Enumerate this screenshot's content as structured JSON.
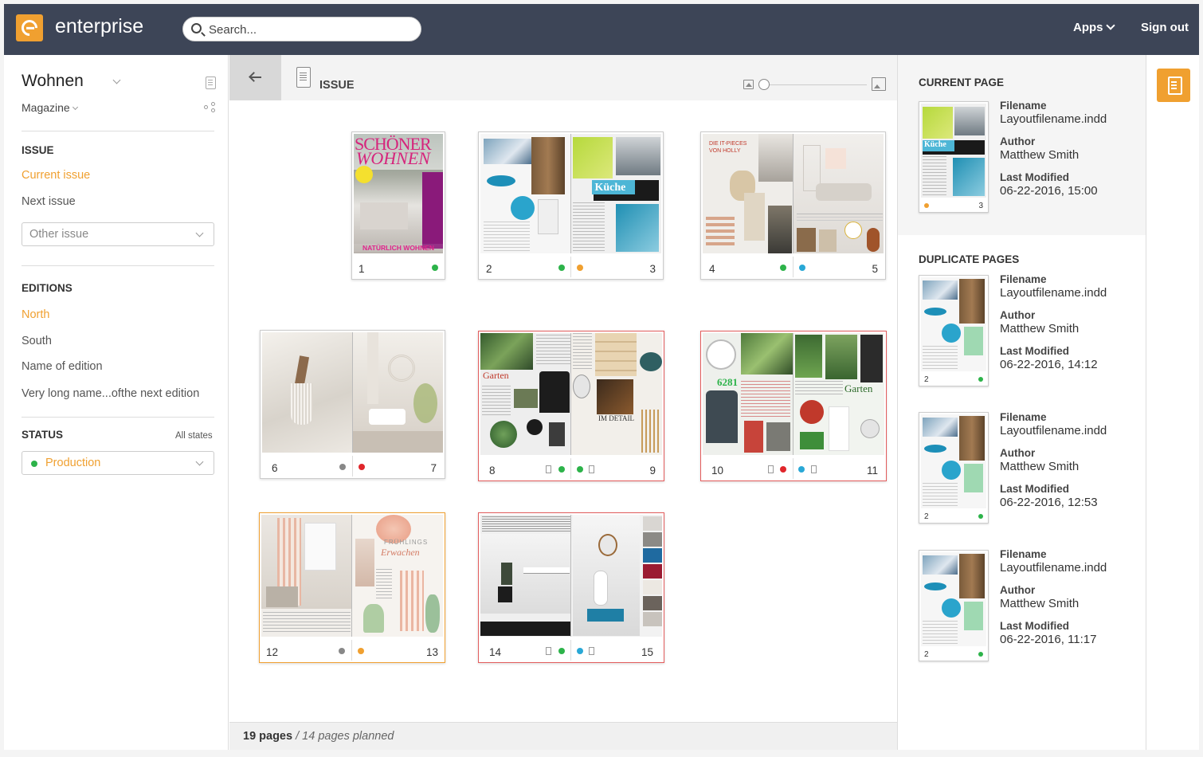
{
  "header": {
    "brand": "enterprise",
    "search_placeholder": "Search...",
    "apps_label": "Apps",
    "signout_label": "Sign out"
  },
  "sidebar": {
    "publication": "Wohnen",
    "publication_type": "Magazine",
    "issue_section": "ISSUE",
    "issue_items": [
      "Current issue",
      "Next issue"
    ],
    "other_issue_placeholder": "Other issue",
    "editions_section": "EDITIONS",
    "edition_items": [
      "North",
      "South",
      "Name of edition",
      "Very long name...ofthe next edition"
    ],
    "status_section": "STATUS",
    "all_states": "All states",
    "status_value": "Production"
  },
  "center": {
    "header_label": "ISSUE",
    "footer_count": "19 pages",
    "footer_planned": "/ 14 pages planned",
    "cover_text_1": "SCHÖNER",
    "cover_text_2": "WOHNEN",
    "cover_text_3": "NATÜRLICH WOHNEN",
    "label_kueche": "Küche",
    "label_it_pieces": "DIE IT-PIECES VON HOLLY",
    "label_garten": "Garten",
    "label_im_detail": "IM DETAIL",
    "label_6281": "6281",
    "label_fruehlings": "FRÜHLINGS",
    "label_erwachen": "Erwachen",
    "cards": [
      {
        "left": "1",
        "right": ""
      },
      {
        "left": "2",
        "right": "3"
      },
      {
        "left": "4",
        "right": "5"
      },
      {
        "left": "6",
        "right": "7"
      },
      {
        "left": "8",
        "right": "9"
      },
      {
        "left": "10",
        "right": "11"
      },
      {
        "left": "12",
        "right": "13"
      },
      {
        "left": "14",
        "right": "15"
      }
    ]
  },
  "right_panel": {
    "current_title": "CURRENT PAGE",
    "duplicate_title": "DUPLICATE PAGES",
    "labels": {
      "filename": "Filename",
      "author": "Author",
      "modified": "Last Modified"
    },
    "current": {
      "page": "3",
      "filename": "Layoutfilename.indd",
      "author": "Matthew Smith",
      "modified": "06-22-2016, 15:00"
    },
    "duplicates": [
      {
        "page": "2",
        "filename": "Layoutfilename.indd",
        "author": "Matthew Smith",
        "modified": "06-22-2016, 14:12"
      },
      {
        "page": "2",
        "filename": "Layoutfilename.indd",
        "author": "Matthew Smith",
        "modified": "06-22-2016, 12:53"
      },
      {
        "page": "2",
        "filename": "Layoutfilename.indd",
        "author": "Matthew Smith",
        "modified": "06-22-2016, 11:17"
      }
    ]
  },
  "colors": {
    "accent": "#f0a030",
    "topbar": "#3d4557",
    "status_green": "#2db34a",
    "status_orange": "#f0a030",
    "status_blue": "#29a8d6",
    "status_red": "#e0262b",
    "status_grey": "#888888",
    "card_error_border": "#e35d5d"
  }
}
